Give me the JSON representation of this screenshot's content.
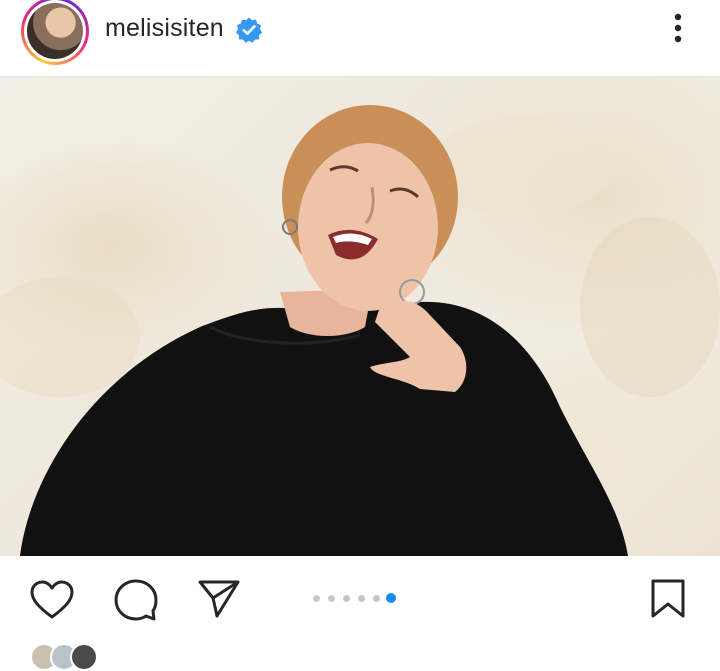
{
  "post": {
    "username": "melisisiten",
    "verified": true,
    "verified_badge_color": "#3897f0",
    "more_icon": "more-vertical-icon",
    "image_description_icons": [
      "like-icon",
      "comment-icon",
      "share-icon",
      "save-icon"
    ]
  },
  "carousel": {
    "total": 6,
    "active_index": 5,
    "active_color": "#1a8cf0",
    "inactive_color": "#c7c7c7"
  }
}
